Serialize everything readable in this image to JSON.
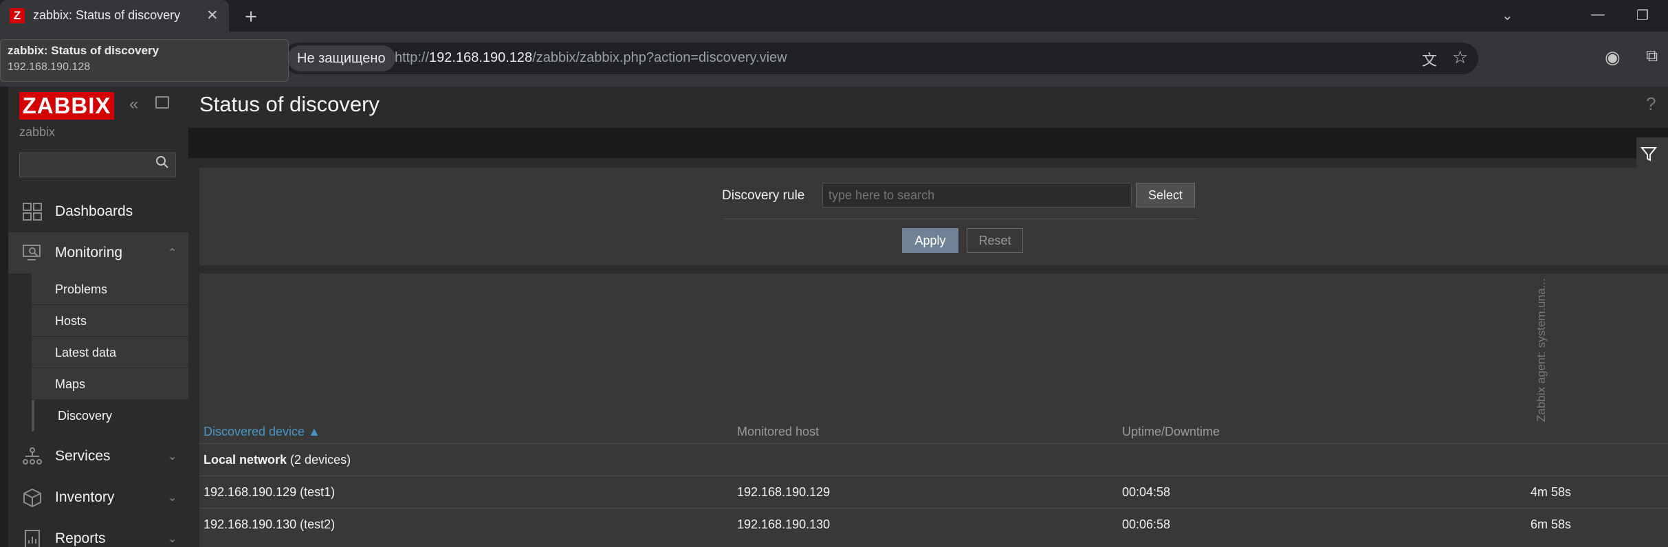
{
  "browser": {
    "tab_title": "zabbix: Status of discovery",
    "tab_favicon": "Z",
    "security_label": "Не защищено",
    "url_prefix": "http://",
    "url_host": "192.168.190.128",
    "url_path": "/zabbix/zabbix.php?action=discovery.view",
    "tooltip_title": "zabbix: Status of discovery",
    "tooltip_host": "192.168.190.128"
  },
  "sidebar": {
    "logo": "ZABBIX",
    "server_name": "zabbix",
    "search_value": "",
    "nav": {
      "dashboards": "Dashboards",
      "monitoring": "Monitoring",
      "services": "Services",
      "inventory": "Inventory",
      "reports": "Reports"
    },
    "monitoring_sub": {
      "problems": "Problems",
      "hosts": "Hosts",
      "latest_data": "Latest data",
      "maps": "Maps",
      "discovery": "Discovery"
    }
  },
  "main": {
    "title": "Status of discovery",
    "help": "?",
    "filter": {
      "rule_label": "Discovery rule",
      "rule_placeholder": "type here to search",
      "select_label": "Select",
      "apply_label": "Apply",
      "reset_label": "Reset"
    },
    "table": {
      "col_device": "Discovered device ▲",
      "col_monitored": "Monitored host",
      "col_uptime": "Uptime/Downtime",
      "col_check": "Zabbix agent: system.una...",
      "group_name": "Local network",
      "group_count": "(2 devices)",
      "rows": [
        {
          "device": "192.168.190.129 (test1)",
          "monitored": "192.168.190.129",
          "uptime": "00:04:58",
          "check": "4m 58s"
        },
        {
          "device": "192.168.190.130 (test2)",
          "monitored": "192.168.190.130",
          "uptime": "00:06:58",
          "check": "6m 58s"
        }
      ]
    }
  },
  "colors": {
    "accent_red": "#d40000",
    "link_blue": "#4796c4",
    "apply_button": "#708394",
    "panel": "#383838",
    "background": "#2b2b2b"
  }
}
